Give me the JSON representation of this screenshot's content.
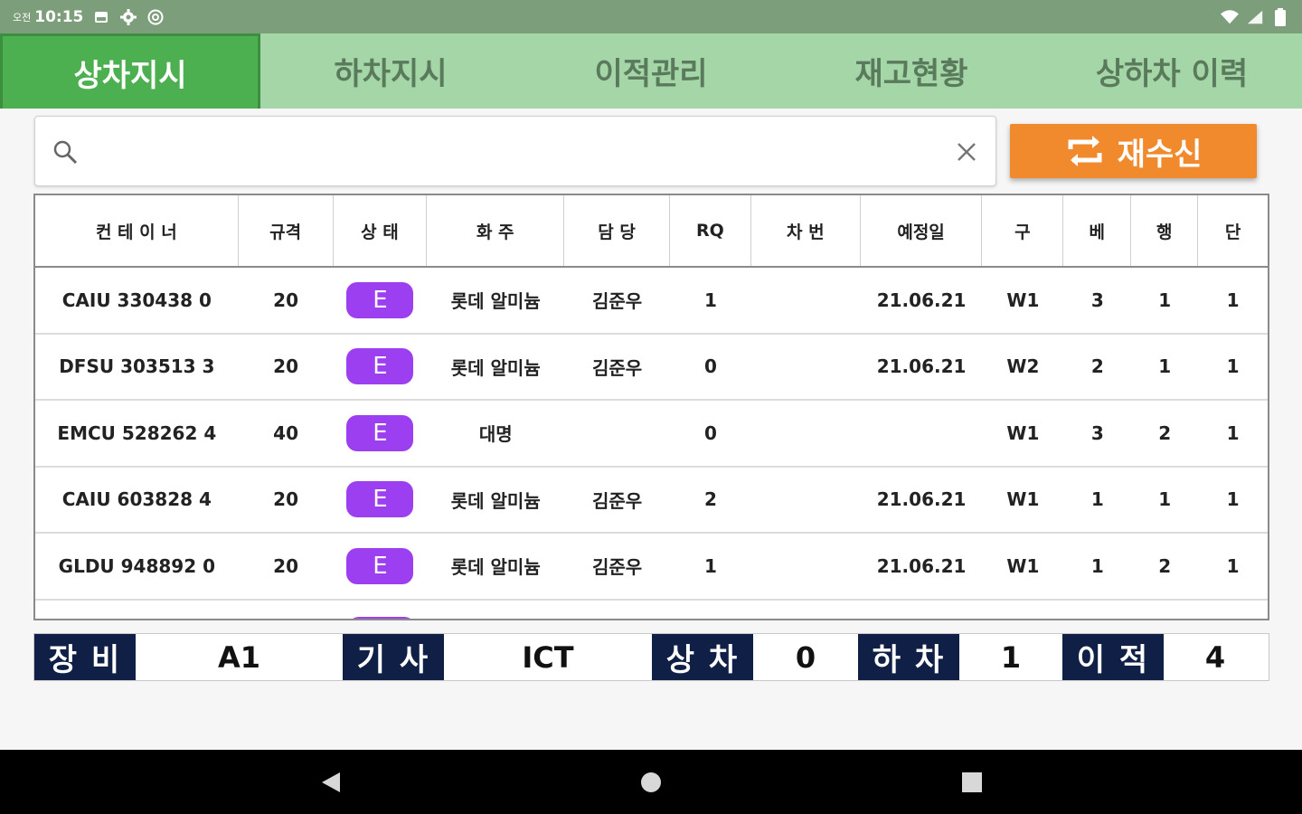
{
  "status_bar": {
    "ampm": "오전",
    "time": "10:15"
  },
  "tabs": [
    {
      "label": "상차지시",
      "active": true
    },
    {
      "label": "하차지시",
      "active": false
    },
    {
      "label": "이적관리",
      "active": false
    },
    {
      "label": "재고현황",
      "active": false
    },
    {
      "label": "상하차 이력",
      "active": false
    }
  ],
  "search": {
    "value": "",
    "placeholder": ""
  },
  "refresh_button": {
    "label": "재수신"
  },
  "table": {
    "headers": [
      "컨 테 이 너",
      "규격",
      "상 태",
      "화 주",
      "담 당",
      "RQ",
      "차 번",
      "예정일",
      "구",
      "베",
      "행",
      "단"
    ],
    "rows": [
      [
        "CAIU 330438 0",
        "20",
        "E",
        "롯데 알미늄",
        "김준우",
        "1",
        "",
        "21.06.21",
        "W1",
        "3",
        "1",
        "1"
      ],
      [
        "DFSU 303513 3",
        "20",
        "E",
        "롯데 알미늄",
        "김준우",
        "0",
        "",
        "21.06.21",
        "W2",
        "2",
        "1",
        "1"
      ],
      [
        "EMCU 528262 4",
        "40",
        "E",
        "대명",
        "",
        "0",
        "",
        "",
        "W1",
        "3",
        "2",
        "1"
      ],
      [
        "CAIU 603828 4",
        "20",
        "E",
        "롯데 알미늄",
        "김준우",
        "2",
        "",
        "21.06.21",
        "W1",
        "1",
        "1",
        "1"
      ],
      [
        "GLDU 948892 0",
        "20",
        "E",
        "롯데 알미늄",
        "김준우",
        "1",
        "",
        "21.06.21",
        "W1",
        "1",
        "2",
        "1"
      ]
    ]
  },
  "summary": {
    "equipment_label": "장 비",
    "equipment_value": "A1",
    "driver_label": "기 사",
    "driver_value": "ICT",
    "load_label": "상 차",
    "load_value": "0",
    "unload_label": "하 차",
    "unload_value": "1",
    "transfer_label": "이 적",
    "transfer_value": "4"
  },
  "colors": {
    "status_bar": "#7d9e7a",
    "tab_bar": "#a5d6a7",
    "tab_active": "#4caf50",
    "refresh_button": "#f18a2c",
    "status_badge": "#9c3ff0",
    "summary_label": "#0f1f45"
  },
  "icons": {
    "status_left": [
      "photo-icon",
      "settings-icon",
      "at-icon"
    ],
    "status_right": [
      "wifi-icon",
      "signal-icon",
      "battery-icon"
    ],
    "search": "search-icon",
    "clear": "close-icon",
    "refresh": "repeat-icon",
    "nav": [
      "back-icon",
      "home-icon",
      "recents-icon"
    ]
  }
}
